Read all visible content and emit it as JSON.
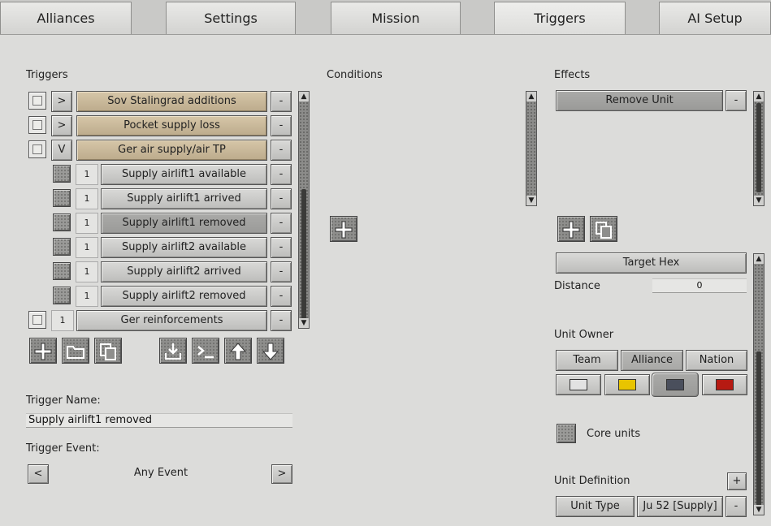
{
  "tabs": [
    "Alliances",
    "Settings",
    "Mission",
    "Triggers",
    "AI Setup"
  ],
  "active_tab": "Triggers",
  "triggers_panel": {
    "title": "Triggers",
    "rows": [
      {
        "toggle": ">",
        "number": "",
        "name": "Sov Stalingrad additions",
        "remove": "-"
      },
      {
        "toggle": ">",
        "number": "",
        "name": "Pocket supply loss",
        "remove": "-"
      },
      {
        "toggle": "V",
        "number": "",
        "name": "Ger air supply/air TP",
        "remove": "-"
      },
      {
        "toggle": "",
        "number": "1",
        "name": "Supply airlift1 available",
        "remove": "-"
      },
      {
        "toggle": "",
        "number": "1",
        "name": "Supply airlift1 arrived",
        "remove": "-"
      },
      {
        "toggle": "",
        "number": "1",
        "name": "Supply airlift1 removed",
        "remove": "-"
      },
      {
        "toggle": "",
        "number": "1",
        "name": "Supply airlift2 available",
        "remove": "-"
      },
      {
        "toggle": "",
        "number": "1",
        "name": "Supply airlift2 arrived",
        "remove": "-"
      },
      {
        "toggle": "",
        "number": "1",
        "name": "Supply airlift2 removed",
        "remove": "-"
      },
      {
        "toggle": "",
        "number": "1",
        "name": "Ger reinforcements",
        "remove": "-"
      }
    ],
    "trigger_name_label": "Trigger Name:",
    "trigger_name_value": "Supply airlift1 removed",
    "trigger_event_label": "Trigger Event:",
    "event_prev": "<",
    "event_value": "Any Event",
    "event_next": ">"
  },
  "conditions_panel": {
    "title": "Conditions"
  },
  "effects_panel": {
    "title": "Effects",
    "effect_item": "Remove Unit",
    "effect_remove": "-",
    "target_hex_label": "Target Hex",
    "distance_label": "Distance",
    "distance_value": "0",
    "unit_owner_label": "Unit Owner",
    "owner_buttons": [
      "Team",
      "Alliance",
      "Nation"
    ],
    "selected_owner": "Alliance",
    "owner_colors": [
      "#e2e2e2",
      "#e8c400",
      "#4a4f5c",
      "#b61a12"
    ],
    "core_units_label": "Core units",
    "unit_definition_label": "Unit Definition",
    "unit_def_add": "+",
    "unit_type_label": "Unit Type",
    "unit_type_value": "Ju 52 [Supply]",
    "unit_type_remove": "-"
  }
}
